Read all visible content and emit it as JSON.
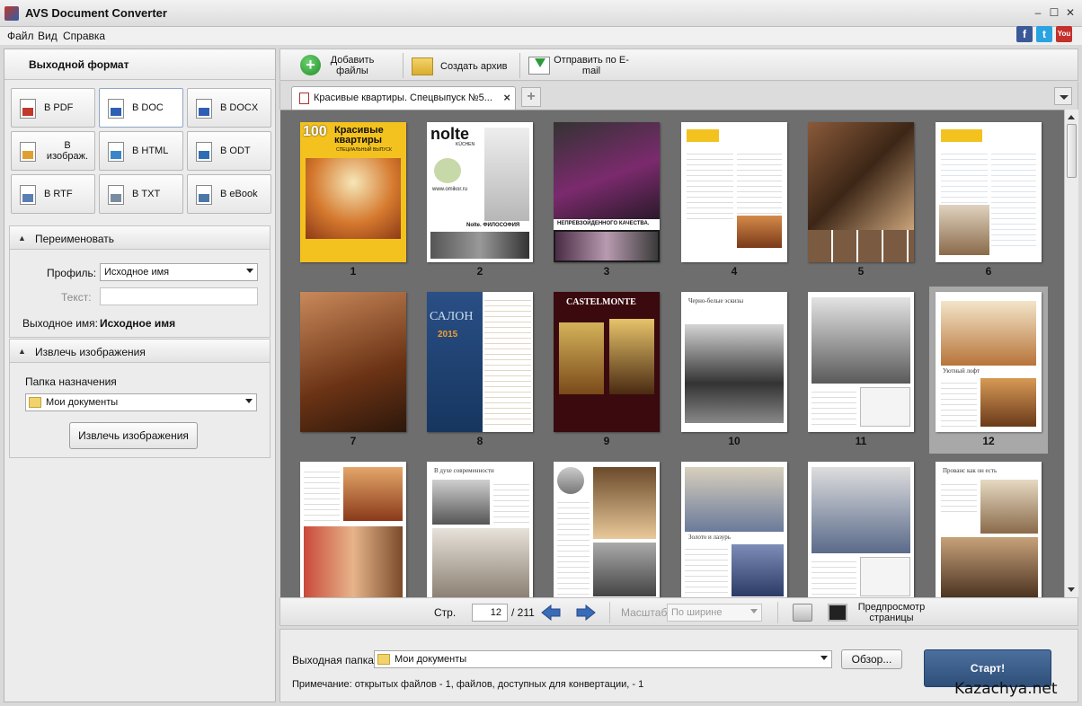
{
  "window": {
    "title": "AVS Document Converter",
    "min": "–",
    "max": "☐",
    "close": "✕"
  },
  "menu": [
    "Файл",
    "Вид",
    "Справка"
  ],
  "social": {
    "facebook": "f",
    "twitter": "t",
    "youtube": "You"
  },
  "left_panel": {
    "header": "Выходной формат",
    "formats": [
      "В PDF",
      "В DOC",
      "В DOCX",
      "В изображ.",
      "В HTML",
      "В ODT",
      "В RTF",
      "В TXT",
      "В eBook"
    ],
    "active_format": "В DOC",
    "rename": {
      "title": "Переименовать",
      "profile_label": "Профиль:",
      "profile_value": "Исходное имя",
      "text_label": "Текст:",
      "text_value": "",
      "output_name_label": "Выходное имя:",
      "output_name_value": "Исходное имя"
    },
    "extract": {
      "title": "Извлечь изображения",
      "folder_label": "Папка назначения",
      "folder_value": "Мои документы",
      "button": "Извлечь изображения"
    }
  },
  "toolbar": {
    "add_files": "Добавить файлы",
    "create_archive": "Создать архив",
    "send_email": "Отправить по E-mail"
  },
  "document_tab": {
    "title": "Красивые квартиры. Спецвыпуск №5...",
    "add": "+"
  },
  "viewer": {
    "page_numbers": [
      "1",
      "2",
      "3",
      "4",
      "5",
      "6",
      "7",
      "8",
      "9",
      "10",
      "11",
      "12"
    ],
    "selected_page": "12",
    "cover_text": {
      "p1_title": "Красивые квартиры",
      "p1_sub": "СПЕЦИАЛЬНЫЙ ВЫПУСК",
      "p1_num": "100",
      "p2_brand": "nolte",
      "p2_sub": "KÜCHEN",
      "p2_url": "www.omikor.ru",
      "p2_caption": "Nolte. ФИЛОСОФИЯ",
      "p3_caption": "НЕПРЕВЗОЙДЕННОГО КАЧЕСТВА.",
      "p8_title": "САЛОН",
      "p8_year": "2015",
      "p9_brand": "CASTELMONTE",
      "p10_heading": "Черно-белые эскизы",
      "p12_heading": "Уютный лофт",
      "p14_heading": "В духе современности",
      "p16_heading": "Золото и лазурь",
      "p18_heading": "Прованс как он есть"
    }
  },
  "statusbar": {
    "page_label": "Стр.",
    "page_value": "12",
    "total": "/ 211",
    "zoom_label": "Масштаб",
    "zoom_value": "По ширине",
    "preview_label": "Предпросмотр страницы"
  },
  "bottom": {
    "output_folder_label": "Выходная папка:",
    "output_folder_value": "Мои документы",
    "browse": "Обзор...",
    "note": "Примечание: открытых файлов - 1, файлов, доступных для конвертации, - 1",
    "start": "Старт!"
  },
  "watermark": "Kazachya.net"
}
